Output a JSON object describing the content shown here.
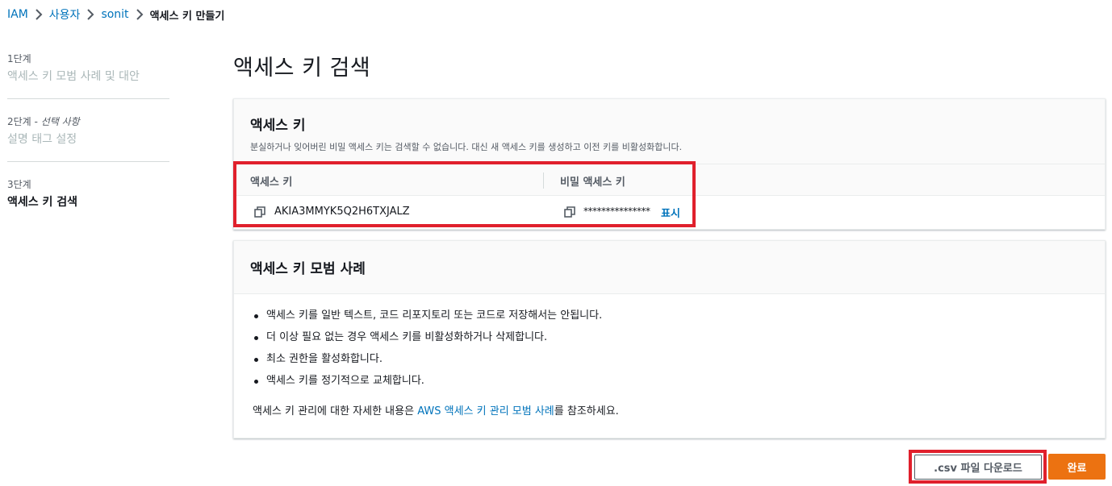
{
  "breadcrumb": {
    "items": [
      "IAM",
      "사용자",
      "sonit"
    ],
    "current": "액세스 키 만들기"
  },
  "steps": [
    {
      "num": "1단계",
      "title": "액세스 키 모범 사례 및 대안"
    },
    {
      "num": "2단계",
      "optional": "- 선택 사항",
      "title": "설명 태그 설정"
    },
    {
      "num": "3단계",
      "title": "액세스 키 검색"
    }
  ],
  "page_title": "액세스 키 검색",
  "keys_panel": {
    "title": "액세스 키",
    "description": "분실하거나 잊어버린 비밀 액세스 키는 검색할 수 없습니다. 대신 새 액세스 키를 생성하고 이전 키를 비활성화합니다.",
    "col_access": "액세스 키",
    "col_secret": "비밀 액세스 키",
    "access_key_value": "AKIA3MMYK5Q2H6TXJALZ",
    "secret_key_masked": "***************",
    "show_label": "표시"
  },
  "best_practices": {
    "title": "액세스 키 모범 사례",
    "items": [
      "액세스 키를 일반 텍스트, 코드 리포지토리 또는 코드로 저장해서는 안됩니다.",
      "더 이상 필요 없는 경우 액세스 키를 비활성화하거나 삭제합니다.",
      "최소 권한을 활성화합니다.",
      "액세스 키를 정기적으로 교체합니다."
    ],
    "footer_before": "액세스 키 관리에 대한 자세한 내용은 ",
    "footer_link": "AWS 액세스 키 관리 모범 사례",
    "footer_after": "를 참조하세요."
  },
  "buttons": {
    "csv": ".csv 파일 다운로드",
    "done": "완료"
  },
  "colors": {
    "link": "#0073bb",
    "primary": "#ec7211",
    "highlight": "#e0202c"
  }
}
